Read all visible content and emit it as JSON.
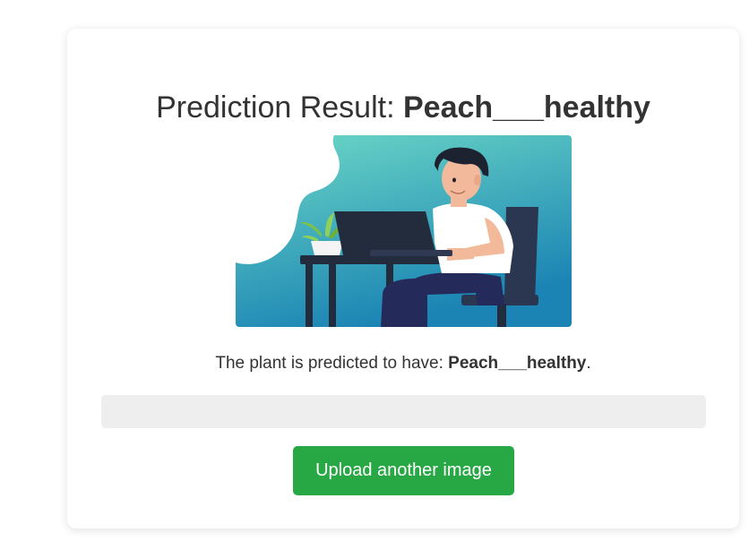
{
  "result": {
    "title_prefix": "Prediction Result: ",
    "label": "Peach___healthy",
    "description_prefix": "The plant is predicted to have: ",
    "description_suffix": "."
  },
  "illustration": {
    "icon": "person-at-laptop-illustration",
    "colors": {
      "gradient_top": "#6dd9c6",
      "gradient_bottom": "#1b84b4",
      "laptop": "#232c3c",
      "shirt": "#ffffff",
      "skin": "#f2b99a",
      "hair": "#1d2230",
      "pants": "#242b5a",
      "plant": "#7cc24a"
    }
  },
  "actions": {
    "upload_label": "Upload another image"
  },
  "colors": {
    "button": "#28a745",
    "bar": "#eeeeee",
    "text": "#333333"
  }
}
